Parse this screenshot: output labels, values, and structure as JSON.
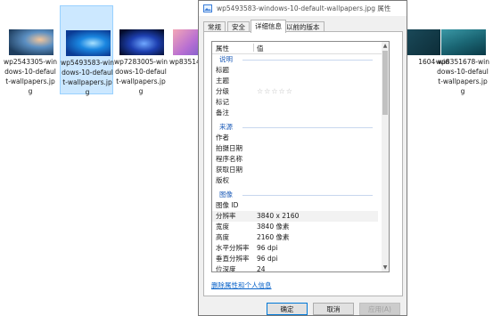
{
  "explorer": {
    "files": [
      {
        "label": "wp2543305-windows-10-default-wallpapers.jpg"
      },
      {
        "label": "wp5493583-windows-10-default-wallpapers.jpg"
      },
      {
        "label": "wp7283005-windows-10-default-wallpapers.jpg"
      },
      {
        "label": "wp83514"
      },
      {
        "label": "1604-win"
      },
      {
        "label": "wp8351678-windows-10-default-wallpapers.jpg"
      }
    ]
  },
  "dialog": {
    "title": "wp5493583-windows-10-default-wallpapers.jpg 属性",
    "tabs": [
      "常规",
      "安全",
      "详细信息",
      "以前的版本"
    ],
    "active_tab": "详细信息",
    "grid": {
      "col_property": "属性",
      "col_value": "值",
      "section_description": "说明",
      "title_label": "标题",
      "subject_label": "主题",
      "rating_label": "分级",
      "rating_stars": "☆☆☆☆☆",
      "tags_label": "标记",
      "comments_label": "备注",
      "section_origin": "来源",
      "authors_label": "作者",
      "date_taken_label": "拍摄日期",
      "program_label": "程序名称",
      "date_acquired_label": "获取日期",
      "copyright_label": "版权",
      "section_image": "图像",
      "image_id_label": "图像 ID",
      "dimensions_label": "分辨率",
      "dimensions_value": "3840 x 2160",
      "width_label": "宽度",
      "width_value": "3840 像素",
      "height_label": "高度",
      "height_value": "2160 像素",
      "hres_label": "水平分辨率",
      "hres_value": "96 dpi",
      "vres_label": "垂直分辨率",
      "vres_value": "96 dpi",
      "bitdepth_label": "位深度",
      "bitdepth_value": "24"
    },
    "remove_link": "删除属性和个人信息",
    "buttons": {
      "ok": "确定",
      "cancel": "取消",
      "apply": "应用(A)"
    }
  }
}
